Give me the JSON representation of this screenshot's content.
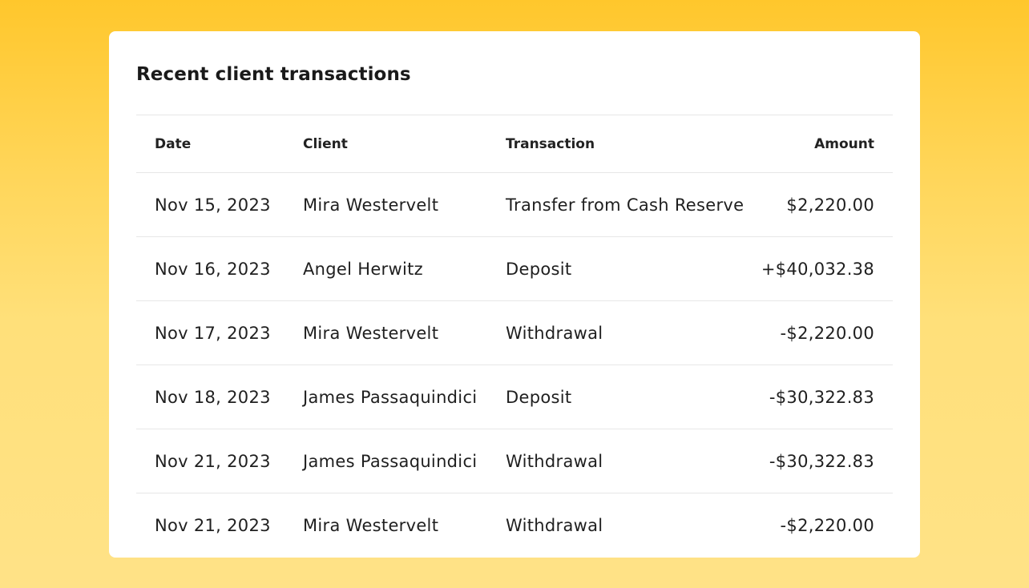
{
  "card": {
    "title": "Recent client transactions"
  },
  "table": {
    "headers": {
      "date": "Date",
      "client": "Client",
      "transaction": "Transaction",
      "amount": "Amount"
    },
    "rows": [
      {
        "date": "Nov 15, 2023",
        "client": "Mira Westervelt",
        "transaction": "Transfer from Cash Reserve",
        "amount": "$2,220.00"
      },
      {
        "date": "Nov 16, 2023",
        "client": "Angel Herwitz",
        "transaction": "Deposit",
        "amount": "+$40,032.38"
      },
      {
        "date": "Nov 17, 2023",
        "client": "Mira Westervelt",
        "transaction": "Withdrawal",
        "amount": "-$2,220.00"
      },
      {
        "date": "Nov 18, 2023",
        "client": "James Passaquindici",
        "transaction": "Deposit",
        "amount": "-$30,322.83"
      },
      {
        "date": "Nov 21, 2023",
        "client": "James Passaquindici",
        "transaction": "Withdrawal",
        "amount": "-$30,322.83"
      },
      {
        "date": "Nov 21, 2023",
        "client": "Mira Westervelt",
        "transaction": "Withdrawal",
        "amount": "-$2,220.00"
      }
    ]
  },
  "colors": {
    "background_top": "#FFC72C",
    "background_bottom": "#FFE287",
    "card": "#FFFFFF",
    "divider": "#E7E7E7",
    "text": "#1D1D1D"
  }
}
